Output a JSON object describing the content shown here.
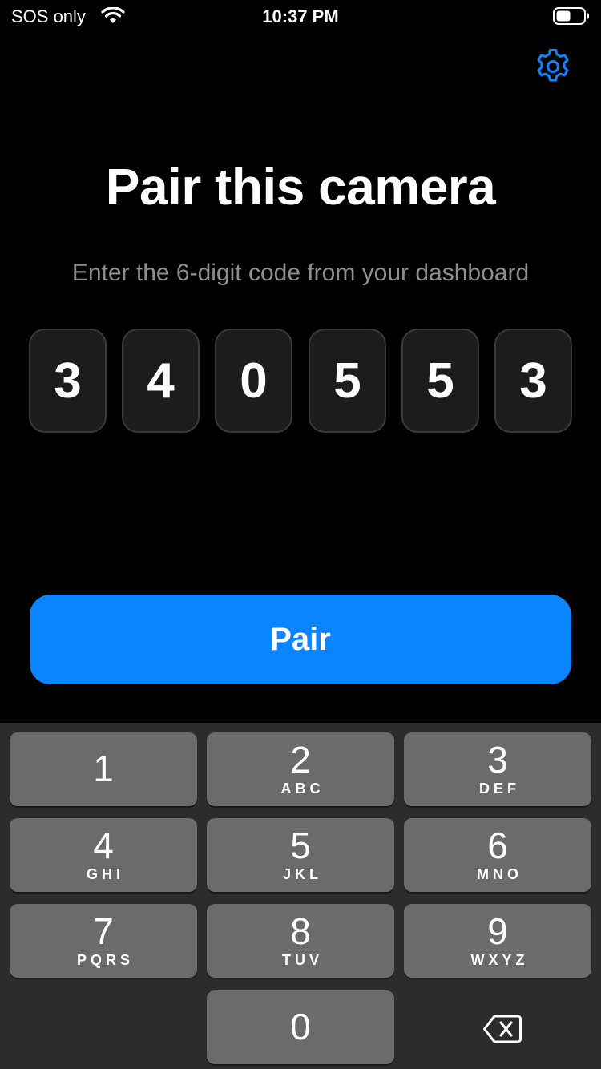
{
  "status_bar": {
    "carrier": "SOS only",
    "time": "10:37 PM",
    "icons": [
      "wifi-icon",
      "battery-icon"
    ]
  },
  "settings": {
    "icon": "gear-icon"
  },
  "title": "Pair this camera",
  "subtitle": "Enter the 6-digit code from your dashboard",
  "code": [
    "3",
    "4",
    "0",
    "5",
    "5",
    "3"
  ],
  "pair_button": {
    "label": "Pair"
  },
  "keyboard": {
    "keys": [
      {
        "number": "1",
        "letters": ""
      },
      {
        "number": "2",
        "letters": "ABC"
      },
      {
        "number": "3",
        "letters": "DEF"
      },
      {
        "number": "4",
        "letters": "GHI"
      },
      {
        "number": "5",
        "letters": "JKL"
      },
      {
        "number": "6",
        "letters": "MNO"
      },
      {
        "number": "7",
        "letters": "PQRS"
      },
      {
        "number": "8",
        "letters": "TUV"
      },
      {
        "number": "9",
        "letters": "WXYZ"
      },
      {
        "number": "0",
        "letters": ""
      }
    ],
    "delete_icon": "backspace-icon"
  },
  "colors": {
    "accent": "#0a84ff",
    "background": "#000000",
    "digit_box": "#1c1c1e",
    "key": "#6b6b6e",
    "keyboard": "#2c2c2e"
  }
}
